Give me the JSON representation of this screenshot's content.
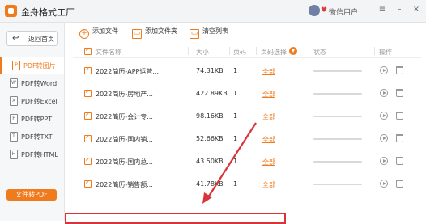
{
  "app": {
    "title": "金舟格式工厂"
  },
  "user": {
    "badge": "♥",
    "name": "微信用户"
  },
  "window_controls": {
    "menu": "≡",
    "minimize": "–",
    "close": "×"
  },
  "sidebar": {
    "back_label": "返回首页",
    "back_icon": "↩",
    "items": [
      {
        "label": "PDF转图片",
        "icon": "P",
        "active": true
      },
      {
        "label": "PDF转Word",
        "icon": "W",
        "active": false
      },
      {
        "label": "PDF转Excel",
        "icon": "X",
        "active": false
      },
      {
        "label": "PDF转PPT",
        "icon": "P",
        "active": false
      },
      {
        "label": "PDF转TXT",
        "icon": "T",
        "active": false
      },
      {
        "label": "PDF转HTML",
        "icon": "H",
        "active": false
      }
    ],
    "convert_button": "文件转PDF"
  },
  "toolbar": {
    "add_file": "添加文件",
    "add_folder": "添加文件夹",
    "clear_list": "清空列表",
    "add_file_icon": "+",
    "add_folder_icon": "▭",
    "clear_icon": "▭"
  },
  "table": {
    "headers": {
      "name": "文件名称",
      "size": "大小",
      "pages": "页码",
      "page_select": "页码选择",
      "status": "状态",
      "actions": "操作"
    },
    "rows": [
      {
        "name": "2022简历-APP运营...",
        "size": "74.31KB",
        "pages": "1",
        "page_select": "全部"
      },
      {
        "name": "2022简历-房地产...",
        "size": "422.89KB",
        "pages": "1",
        "page_select": "全部"
      },
      {
        "name": "2022简历-会计专...",
        "size": "98.16KB",
        "pages": "1",
        "page_select": "全部"
      },
      {
        "name": "2022简历-国内销...",
        "size": "52.66KB",
        "pages": "1",
        "page_select": "全部"
      },
      {
        "name": "2022简历-国内总...",
        "size": "43.50KB",
        "pages": "1",
        "page_select": "全部"
      },
      {
        "name": "2022简历-销售额...",
        "size": "41.78KB",
        "pages": "1",
        "page_select": "全部"
      }
    ]
  },
  "colors": {
    "accent": "#f07b1d",
    "annotation": "#d9343a"
  }
}
